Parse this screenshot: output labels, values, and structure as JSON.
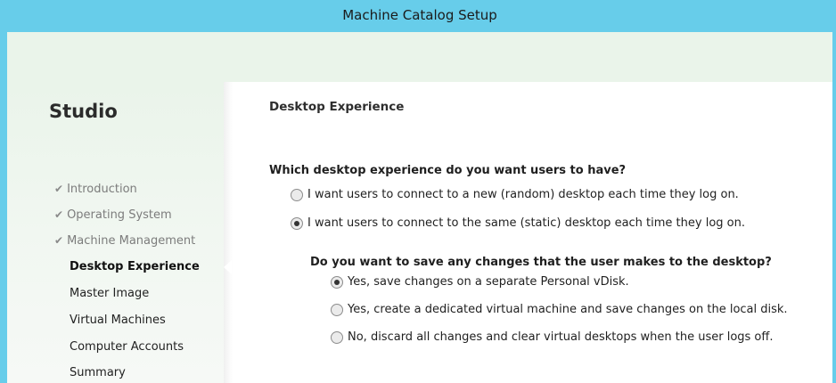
{
  "window": {
    "title": "Machine Catalog Setup",
    "accent_color": "#67cdea",
    "sidebar_bg": "#eaf4ea"
  },
  "sidebar": {
    "title": "Studio",
    "check_icon": "checkmark-icon",
    "items": [
      {
        "label": "Introduction",
        "state": "done"
      },
      {
        "label": "Operating System",
        "state": "done"
      },
      {
        "label": "Machine Management",
        "state": "done"
      },
      {
        "label": "Desktop Experience",
        "state": "active"
      },
      {
        "label": "Master Image",
        "state": "pending"
      },
      {
        "label": "Virtual Machines",
        "state": "pending"
      },
      {
        "label": "Computer Accounts",
        "state": "pending"
      },
      {
        "label": "Summary",
        "state": "pending"
      }
    ]
  },
  "main": {
    "section_title": "Desktop Experience",
    "question1": {
      "text": "Which desktop experience do you want users to have?",
      "options": [
        {
          "label": "I want users to connect to a new (random) desktop each time they log on.",
          "selected": false
        },
        {
          "label": "I want users to connect to the same (static) desktop each time they log on.",
          "selected": true
        }
      ]
    },
    "question2": {
      "text": "Do you want to save any changes that the user makes to the desktop?",
      "options": [
        {
          "label": "Yes, save changes on a separate Personal vDisk.",
          "selected": true
        },
        {
          "label": "Yes, create a dedicated virtual machine and save changes on the local disk.",
          "selected": false
        },
        {
          "label": "No, discard all changes and clear virtual desktops when the user logs off.",
          "selected": false
        }
      ]
    }
  }
}
